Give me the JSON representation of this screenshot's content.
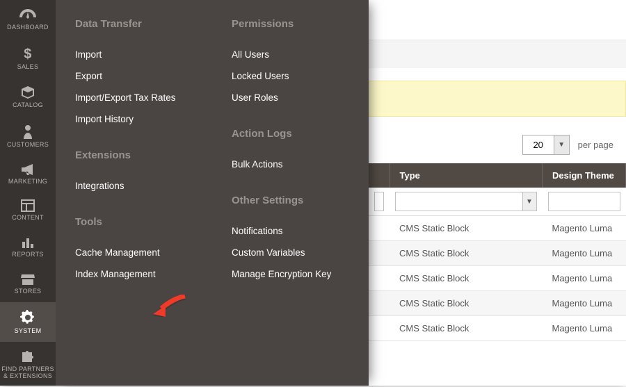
{
  "rail": [
    {
      "id": "dashboard",
      "label": "DASHBOARD"
    },
    {
      "id": "sales",
      "label": "SALES"
    },
    {
      "id": "catalog",
      "label": "CATALOG"
    },
    {
      "id": "customers",
      "label": "CUSTOMERS"
    },
    {
      "id": "marketing",
      "label": "MARKETING"
    },
    {
      "id": "content",
      "label": "CONTENT"
    },
    {
      "id": "reports",
      "label": "REPORTS"
    },
    {
      "id": "stores",
      "label": "STORES"
    },
    {
      "id": "system",
      "label": "SYSTEM",
      "active": true
    },
    {
      "id": "partners",
      "label": "FIND PARTNERS & EXTENSIONS"
    }
  ],
  "flyout": {
    "col1": [
      {
        "heading": "Data Transfer",
        "items": [
          "Import",
          "Export",
          "Import/Export Tax Rates",
          "Import History"
        ]
      },
      {
        "heading": "Extensions",
        "items": [
          "Integrations"
        ]
      },
      {
        "heading": "Tools",
        "items": [
          "Cache Management",
          "Index Management"
        ]
      }
    ],
    "col2": [
      {
        "heading": "Permissions",
        "items": [
          "All Users",
          "Locked Users",
          "User Roles"
        ]
      },
      {
        "heading": "Action Logs",
        "items": [
          "Bulk Actions"
        ]
      },
      {
        "heading": "Other Settings",
        "items": [
          "Notifications",
          "Custom Variables",
          "Manage Encryption Key"
        ]
      }
    ]
  },
  "annotation_target": "Cache Management",
  "pager": {
    "page_size": "20",
    "per_page_label": "per page"
  },
  "grid": {
    "columns": [
      "Type",
      "Design Theme"
    ],
    "rows": [
      {
        "type": "CMS Static Block",
        "theme": "Magento Luma"
      },
      {
        "type": "CMS Static Block",
        "theme": "Magento Luma"
      },
      {
        "type": "CMS Static Block",
        "theme": "Magento Luma"
      },
      {
        "type": "CMS Static Block",
        "theme": "Magento Luma"
      },
      {
        "type": "CMS Static Block",
        "theme": "Magento Luma"
      }
    ]
  }
}
